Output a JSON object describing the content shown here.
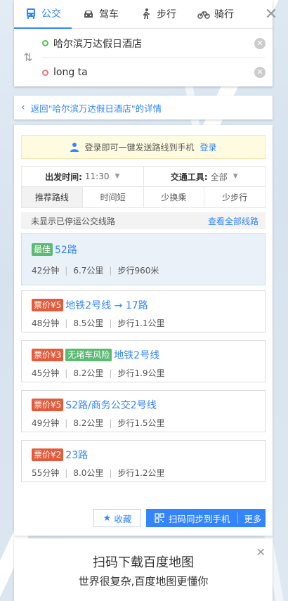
{
  "modes": [
    {
      "label": "公交",
      "icon": "bus-icon",
      "active": true
    },
    {
      "label": "驾车",
      "icon": "car-icon",
      "active": false
    },
    {
      "label": "步行",
      "icon": "walk-icon",
      "active": false
    },
    {
      "label": "骑行",
      "icon": "bike-icon",
      "active": false
    }
  ],
  "inputs": {
    "start": "哈尔滨万达假日酒店",
    "end": "long ta"
  },
  "back_link": "返回\"哈尔滨万达假日酒店\"的详情",
  "login_tip": {
    "text": "登录即可一键发送路线到手机",
    "link": "登录"
  },
  "filters": {
    "depart_label": "出发时间:",
    "depart_value": "11:30",
    "vehicle_label": "交通工具:",
    "vehicle_value": "全部"
  },
  "sort_tabs": [
    "推荐路线",
    "时间短",
    "少换乘",
    "少步行"
  ],
  "notice": {
    "text": "未显示已停运公交线路",
    "link": "查看全部线路"
  },
  "routes": [
    {
      "badges": [
        {
          "type": "best",
          "text": "最佳"
        }
      ],
      "name": "52路",
      "time": "42分钟",
      "distance": "6.7公里",
      "walk": "步行960米"
    },
    {
      "badges": [
        {
          "type": "price",
          "text": "票价¥5"
        }
      ],
      "name": "地铁2号线 → 17路",
      "time": "48分钟",
      "distance": "8.5公里",
      "walk": "步行1.1公里"
    },
    {
      "badges": [
        {
          "type": "price",
          "text": "票价¥3"
        },
        {
          "type": "noJam",
          "text": "无堵车风险"
        }
      ],
      "name": "地铁2号线",
      "time": "45分钟",
      "distance": "8.2公里",
      "walk": "步行1.9公里"
    },
    {
      "badges": [
        {
          "type": "price",
          "text": "票价¥5"
        }
      ],
      "name": "S2路/商务公交2号线",
      "time": "49分钟",
      "distance": "8.2公里",
      "walk": "步行1.5公里"
    },
    {
      "badges": [
        {
          "type": "price",
          "text": "票价¥2"
        }
      ],
      "name": "23路",
      "time": "55分钟",
      "distance": "8.0公里",
      "walk": "步行1.2公里"
    }
  ],
  "actions": {
    "favorite": "收藏",
    "scan": "扫码同步到手机",
    "more": "更多"
  },
  "promo": {
    "line1": "扫码下载百度地图",
    "line2": "世界很复杂,百度地图更懂你"
  },
  "colors": {
    "accent": "#3385ff",
    "price_badge": "#e45b3b",
    "green_badge": "#5cba73"
  }
}
